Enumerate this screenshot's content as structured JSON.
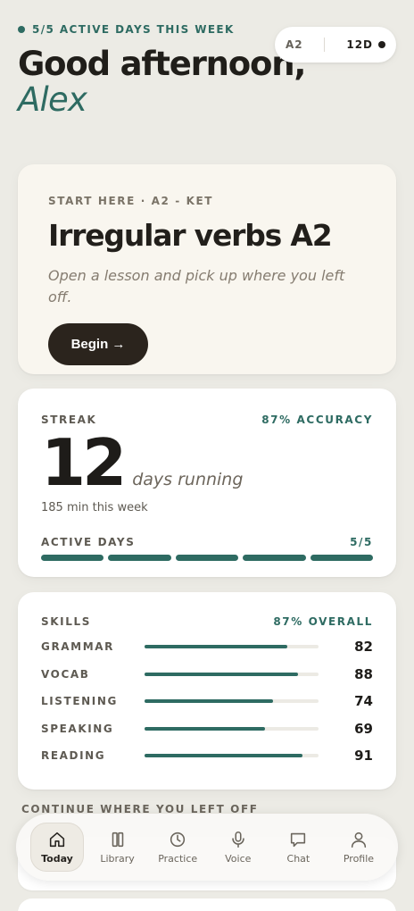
{
  "header": {
    "active_days_label": "5/5 ACTIVE DAYS THIS WEEK",
    "greeting": "Good afternoon,",
    "name": "Alex",
    "level": "A2",
    "streak_badge": "12D"
  },
  "lesson": {
    "eyebrow": "START HERE · A2 - KET",
    "title": "Irregular verbs A2",
    "description": "Open a lesson and pick up where you left off.",
    "button_label": "Begin →"
  },
  "streak": {
    "label": "STREAK",
    "accuracy": "87% ACCURACY",
    "days": "12",
    "days_suffix": "days running",
    "minutes": "185 min this week",
    "active_days_label": "ACTIVE DAYS",
    "active_days_value": "5/5",
    "active_days_filled": 5,
    "active_days_total": 5
  },
  "skills": {
    "label": "SKILLS",
    "overall": "87% OVERALL",
    "items": [
      {
        "name": "GRAMMAR",
        "value": 82
      },
      {
        "name": "VOCAB",
        "value": 88
      },
      {
        "name": "LISTENING",
        "value": 74
      },
      {
        "name": "SPEAKING",
        "value": 69
      },
      {
        "name": "READING",
        "value": 91
      }
    ]
  },
  "continue_label": "CONTINUE WHERE YOU LEFT OFF",
  "tabs": [
    {
      "label": "Today",
      "icon": "home-icon",
      "active": true
    },
    {
      "label": "Library",
      "icon": "library-icon",
      "active": false
    },
    {
      "label": "Practice",
      "icon": "clock-icon",
      "active": false
    },
    {
      "label": "Voice",
      "icon": "microphone-icon",
      "active": false
    },
    {
      "label": "Chat",
      "icon": "chat-bubble-icon",
      "active": false
    },
    {
      "label": "Profile",
      "icon": "user-icon",
      "active": false
    }
  ],
  "colors": {
    "accent": "#2e6b62",
    "background": "#ecebe5",
    "dark_button": "#2b241d"
  }
}
